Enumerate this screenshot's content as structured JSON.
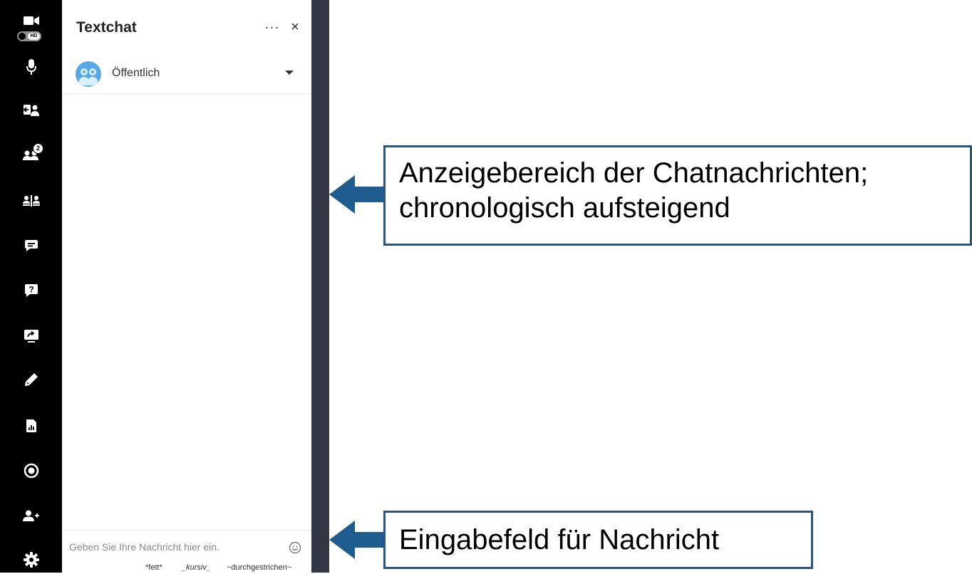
{
  "panel": {
    "title": "Textchat",
    "more_label": "···",
    "close_label": "×",
    "channel": "Öffentlich"
  },
  "input": {
    "placeholder": "Geben Sie Ihre Nachricht hier ein.",
    "value": ""
  },
  "formatting": {
    "bold": "*fett*",
    "italic": "_kursiv_",
    "strike": "~durchgestrichen~"
  },
  "rail": {
    "hd_label": "HD",
    "participants_badge": "2"
  },
  "callouts": {
    "messages_area": "Anzeigebereich der Chatnachrichten; chronologisch aufsteigend",
    "input_field": "Eingabefeld für Nachricht"
  },
  "colors": {
    "rail": "#000000",
    "strip": "#323743",
    "callout_border": "#2c5480",
    "arrow": "#1f5c8f",
    "avatar": "#5aa7e6"
  }
}
